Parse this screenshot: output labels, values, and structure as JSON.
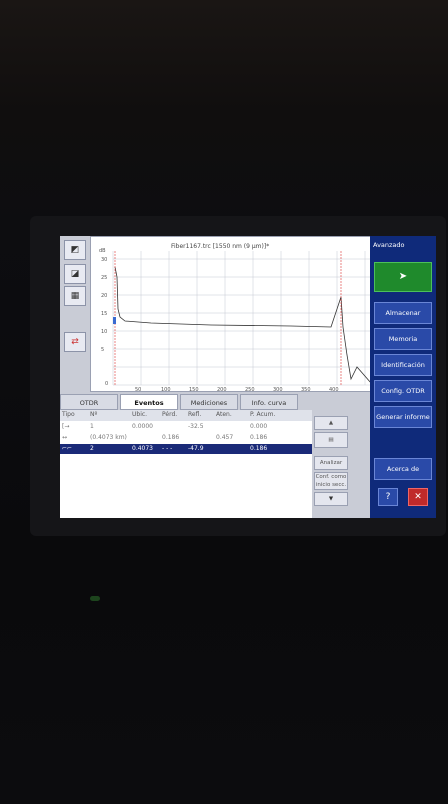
{
  "trace": {
    "title": "Fiber1167.trc [1550 nm (9 µm)]*",
    "y_ticks": [
      "dB",
      "30",
      "25",
      "20",
      "15",
      "10",
      "5",
      "0"
    ],
    "x_ticks": [
      "50",
      "100",
      "150",
      "200",
      "250",
      "300",
      "350",
      "400"
    ]
  },
  "tabs": [
    {
      "label": "OTDR"
    },
    {
      "label": "Eventos"
    },
    {
      "label": "Mediciones"
    },
    {
      "label": "Info. curva"
    }
  ],
  "table": {
    "headers": [
      "Tipo",
      "Nº",
      "Ubic.",
      "Pérd.",
      "Refl.",
      "Aten.",
      "P. Acum."
    ],
    "rows": [
      {
        "num": "1",
        "ubic": "0.0000",
        "perd": "",
        "refl": "-32.5",
        "aten": "",
        "acum": "0.000"
      },
      {
        "num": "(0.4073 km)",
        "ubic": "",
        "perd": "0.186",
        "refl": "",
        "aten": "0.457",
        "acum": "0.186"
      },
      {
        "num": "2",
        "ubic": "0.4073",
        "perd": "- - -",
        "refl": "-47.9",
        "aten": "",
        "acum": "0.186"
      }
    ]
  },
  "side": {
    "analyze": "Analizar",
    "conf": "Conf. como inicio secc."
  },
  "menu": {
    "title": "Avanzado",
    "items": [
      "Almacenar",
      "Memoria",
      "Identificación",
      "Config. OTDR",
      "Generar informe",
      "Acerca de"
    ]
  },
  "colors": {
    "menu": "#0f2a7a",
    "selected_row": "#1a2a78",
    "green": "#1f8a2c"
  }
}
